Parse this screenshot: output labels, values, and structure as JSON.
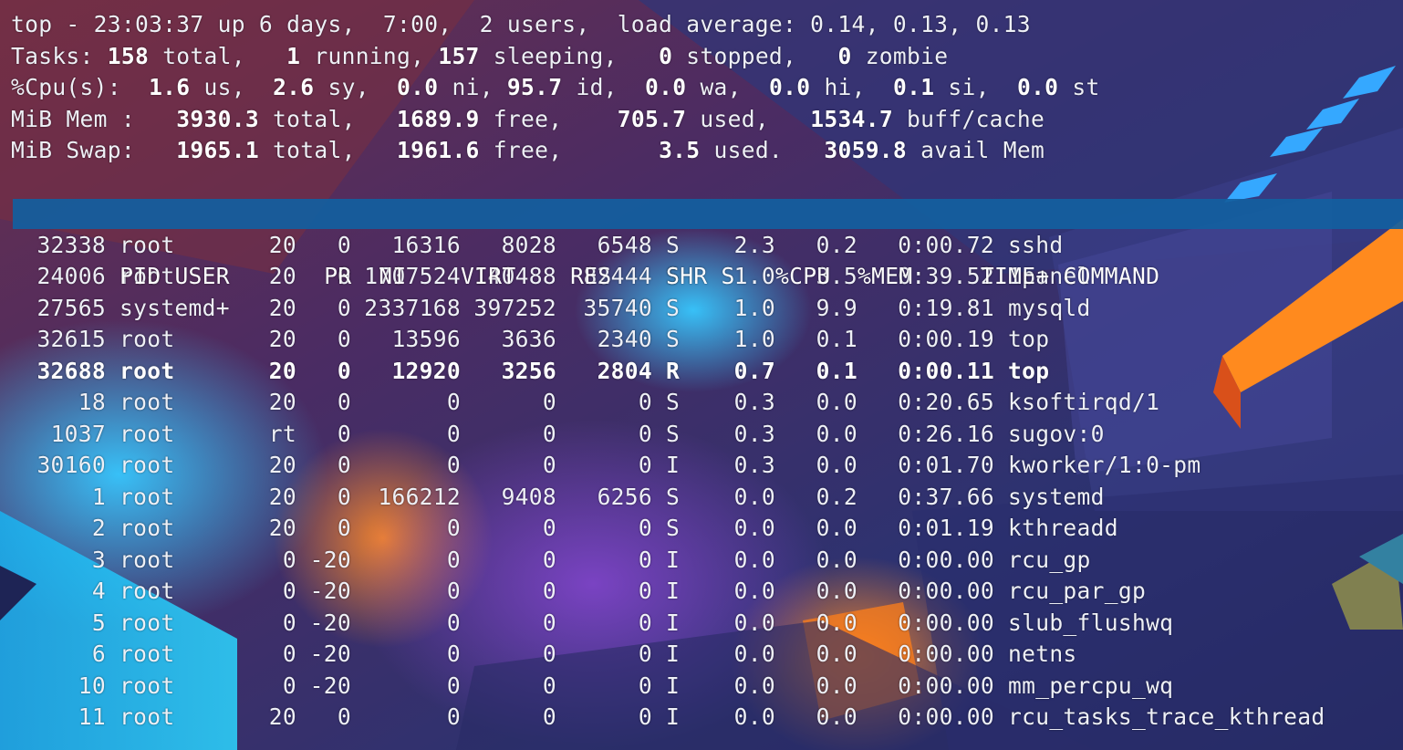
{
  "summary": {
    "uptime_line": "top - 23:03:37 up 6 days,  7:00,  2 users,  load average: 0.14, 0.13, 0.13",
    "tasks": {
      "label": "Tasks:",
      "total": "158",
      "total_label": "total,",
      "running": "1",
      "running_label": "running,",
      "sleeping": "157",
      "sleeping_label": "sleeping,",
      "stopped": "0",
      "stopped_label": "stopped,",
      "zombie": "0",
      "zombie_label": "zombie"
    },
    "cpu": {
      "label": "%Cpu(s):",
      "us": "1.6",
      "us_label": "us,",
      "sy": "2.6",
      "sy_label": "sy,",
      "ni": "0.0",
      "ni_label": "ni,",
      "id": "95.7",
      "id_label": "id,",
      "wa": "0.0",
      "wa_label": "wa,",
      "hi": "0.0",
      "hi_label": "hi,",
      "si": "0.1",
      "si_label": "si,",
      "st": "0.0",
      "st_label": "st"
    },
    "mem": {
      "label": "MiB Mem :",
      "total": "3930.3",
      "total_label": "total,",
      "free": "1689.9",
      "free_label": "free,",
      "used": "705.7",
      "used_label": "used,",
      "buff": "1534.7",
      "buff_label": "buff/cache"
    },
    "swap": {
      "label": "MiB Swap:",
      "total": "1965.1",
      "total_label": "total,",
      "free": "1961.6",
      "free_label": "free,",
      "used": "3.5",
      "used_label": "used.",
      "avail": "3059.8",
      "avail_label": "avail Mem"
    }
  },
  "columns": [
    "PID",
    "USER",
    "PR",
    "NI",
    "VIRT",
    "RES",
    "SHR",
    "S",
    "%CPU",
    "%MEM",
    "TIME+",
    "COMMAND"
  ],
  "processes": [
    [
      "32338",
      "root",
      "20",
      "0",
      "16316",
      "8028",
      "6548",
      "S",
      "2.3",
      "0.2",
      "0:00.72",
      "sshd"
    ],
    [
      "24006",
      "root",
      "20",
      "0",
      "1707524",
      "140488",
      "82444",
      "S",
      "1.0",
      "3.5",
      "0:39.52",
      "1panel"
    ],
    [
      "27565",
      "systemd+",
      "20",
      "0",
      "2337168",
      "397252",
      "35740",
      "S",
      "1.0",
      "9.9",
      "0:19.81",
      "mysqld"
    ],
    [
      "32615",
      "root",
      "20",
      "0",
      "13596",
      "3636",
      "2340",
      "S",
      "1.0",
      "0.1",
      "0:00.19",
      "top"
    ],
    [
      "32688",
      "root",
      "20",
      "0",
      "12920",
      "3256",
      "2804",
      "R",
      "0.7",
      "0.1",
      "0:00.11",
      "top"
    ],
    [
      "18",
      "root",
      "20",
      "0",
      "0",
      "0",
      "0",
      "S",
      "0.3",
      "0.0",
      "0:20.65",
      "ksoftirqd/1"
    ],
    [
      "1037",
      "root",
      "rt",
      "0",
      "0",
      "0",
      "0",
      "S",
      "0.3",
      "0.0",
      "0:26.16",
      "sugov:0"
    ],
    [
      "30160",
      "root",
      "20",
      "0",
      "0",
      "0",
      "0",
      "I",
      "0.3",
      "0.0",
      "0:01.70",
      "kworker/1:0-pm"
    ],
    [
      "1",
      "root",
      "20",
      "0",
      "166212",
      "9408",
      "6256",
      "S",
      "0.0",
      "0.2",
      "0:37.66",
      "systemd"
    ],
    [
      "2",
      "root",
      "20",
      "0",
      "0",
      "0",
      "0",
      "S",
      "0.0",
      "0.0",
      "0:01.19",
      "kthreadd"
    ],
    [
      "3",
      "root",
      "0",
      "-20",
      "0",
      "0",
      "0",
      "I",
      "0.0",
      "0.0",
      "0:00.00",
      "rcu_gp"
    ],
    [
      "4",
      "root",
      "0",
      "-20",
      "0",
      "0",
      "0",
      "I",
      "0.0",
      "0.0",
      "0:00.00",
      "rcu_par_gp"
    ],
    [
      "5",
      "root",
      "0",
      "-20",
      "0",
      "0",
      "0",
      "I",
      "0.0",
      "0.0",
      "0:00.00",
      "slub_flushwq"
    ],
    [
      "6",
      "root",
      "0",
      "-20",
      "0",
      "0",
      "0",
      "I",
      "0.0",
      "0.0",
      "0:00.00",
      "netns"
    ],
    [
      "10",
      "root",
      "0",
      "-20",
      "0",
      "0",
      "0",
      "I",
      "0.0",
      "0.0",
      "0:00.00",
      "mm_percpu_wq"
    ],
    [
      "11",
      "root",
      "20",
      "0",
      "0",
      "0",
      "0",
      "I",
      "0.0",
      "0.0",
      "0:00.00",
      "rcu_tasks_trace_kthread"
    ]
  ],
  "highlighted_pid": "32688",
  "colors": {
    "header_bar": "#1260a0",
    "text": "#eef0f6"
  }
}
